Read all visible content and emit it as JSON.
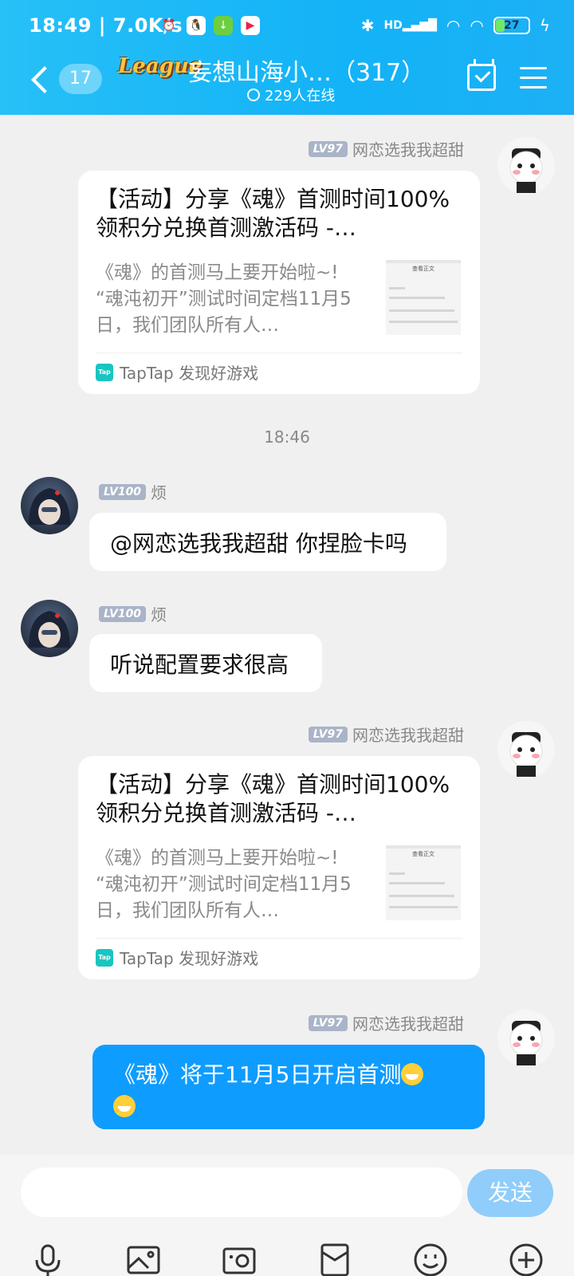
{
  "status_bar": {
    "time": "18:49",
    "speed": "7.0K/s",
    "battery": "27",
    "network": "HD"
  },
  "header": {
    "unread_count": "17",
    "logo_text": "League",
    "title": "妄想山海小…（317）",
    "online": "229人在线"
  },
  "messages": [
    {
      "sender_level": "LV97",
      "sender_name": "网恋选我我超甜",
      "card": {
        "title": "【活动】分享《魂》首测时间100%领积分兑换首测激活码 -…",
        "desc": "《魂》的首测马上要开始啦~! “魂沌初开”测试时间定档11月5日，我们团队所有人…",
        "source": "TapTap 发现好游戏",
        "thumb_title": "查看正文"
      }
    },
    {
      "timestamp": "18:46"
    },
    {
      "sender_level": "LV100",
      "sender_name": "烦",
      "text": "@网恋选我我超甜 你捏脸卡吗"
    },
    {
      "sender_level": "LV100",
      "sender_name": "烦",
      "text": "听说配置要求很高"
    },
    {
      "sender_level": "LV97",
      "sender_name": "网恋选我我超甜",
      "card": {
        "title": "【活动】分享《魂》首测时间100%领积分兑换首测激活码 -…",
        "desc": "《魂》的首测马上要开始啦~! “魂沌初开”测试时间定档11月5日，我们团队所有人…",
        "source": "TapTap 发现好游戏",
        "thumb_title": "查看正文"
      }
    },
    {
      "sender_level": "LV97",
      "sender_name": "网恋选我我超甜",
      "text": "《魂》将于11月5日开启首测"
    }
  ],
  "input": {
    "send_label": "发送"
  },
  "toolbar": [
    "microphone-icon",
    "image-icon",
    "camera-icon",
    "red-packet-icon",
    "emoji-icon",
    "plus-icon"
  ],
  "colors": {
    "header": "#13b3f7",
    "my_bubble": "#0f9cff",
    "send_button": "#90cdfa"
  }
}
